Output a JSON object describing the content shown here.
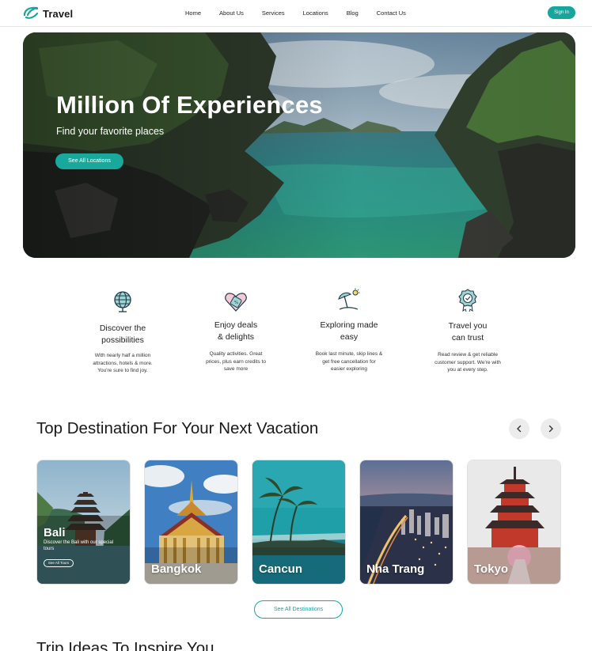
{
  "brand": {
    "name": "Travel",
    "accent": "#16a69c"
  },
  "nav": {
    "items": [
      "Home",
      "About Us",
      "Services",
      "Locations",
      "Blog",
      "Contact Us"
    ],
    "sign_in": "Sign In"
  },
  "hero": {
    "title": "Million Of Experiences",
    "subtitle": "Find your favorite places",
    "button": "See All Locations"
  },
  "features": [
    {
      "icon": "globe-icon",
      "title": "Discover the\npossibilities",
      "description": "With nearly half a million\nattractions, hotels & more.\nYou're sure to find joy."
    },
    {
      "icon": "discount-tag-icon",
      "title": "Enjoy deals\n& delights",
      "description": "Quality activities. Great\nprices, plus earn credits to\nsave more"
    },
    {
      "icon": "beach-umbrella-icon",
      "title": "Exploring made\neasy",
      "description": "Book last minute, skip lines &\nget free cancellation for\neasier exploring"
    },
    {
      "icon": "award-badge-icon",
      "title": "Travel you\ncan trust",
      "description": "Read review & get reliable\ncustomer support. We're with\nyou at every step."
    }
  ],
  "destinations": {
    "title": "Top Destination For Your Next Vacation",
    "prev_icon": "chevron-left-icon",
    "next_icon": "chevron-right-icon",
    "cards": [
      {
        "name": "Bali",
        "description": "Discover the Bali with our special tours",
        "button": "See All Tours"
      },
      {
        "name": "Bangkok"
      },
      {
        "name": "Cancun"
      },
      {
        "name": "Nha Trang"
      },
      {
        "name": "Tokyo"
      }
    ],
    "see_all": "See All Destinations"
  },
  "next_section": {
    "title": "Trip Ideas To Inspire You"
  }
}
